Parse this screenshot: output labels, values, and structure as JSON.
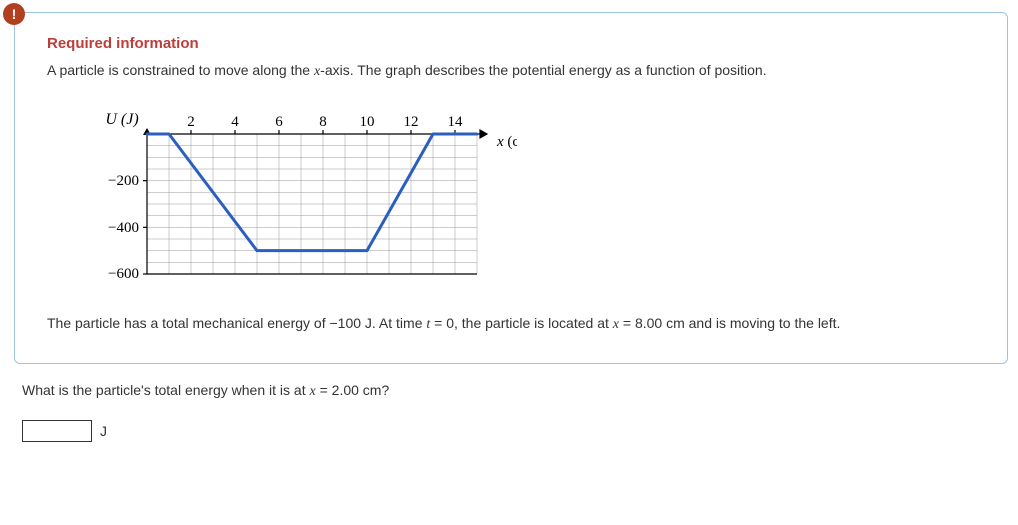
{
  "alert_glyph": "!",
  "card": {
    "heading": "Required information",
    "description_prefix": "A particle is constrained to move along the ",
    "description_var": "x",
    "description_suffix": "-axis. The graph describes the potential energy as a function of position.",
    "footnote": {
      "p1": "The particle has a total mechanical energy of −100 J. At time ",
      "p2": "t",
      "p3": " = 0, the particle is located at ",
      "p4": "x",
      "p5": " = 8.00 cm and is moving to the left."
    }
  },
  "chart": {
    "y_label": "U (J)",
    "x_label": "x (cm)",
    "x_ticks": [
      "2",
      "4",
      "6",
      "8",
      "10",
      "12",
      "14"
    ],
    "y_ticks": [
      "−200",
      "−400",
      "−600"
    ]
  },
  "chart_data": {
    "type": "line",
    "x": [
      0,
      1,
      5,
      10,
      13,
      15
    ],
    "y": [
      0,
      0,
      -500,
      -500,
      0,
      0
    ],
    "xlabel": "x (cm)",
    "ylabel": "U (J)",
    "xlim": [
      0,
      15
    ],
    "ylim": [
      -600,
      0
    ],
    "grid": "minor",
    "title": ""
  },
  "question": {
    "prefix": "What is the particle's total energy when it is at ",
    "var": "x",
    "suffix": " = 2.00 cm?",
    "unit": "J",
    "value": ""
  }
}
